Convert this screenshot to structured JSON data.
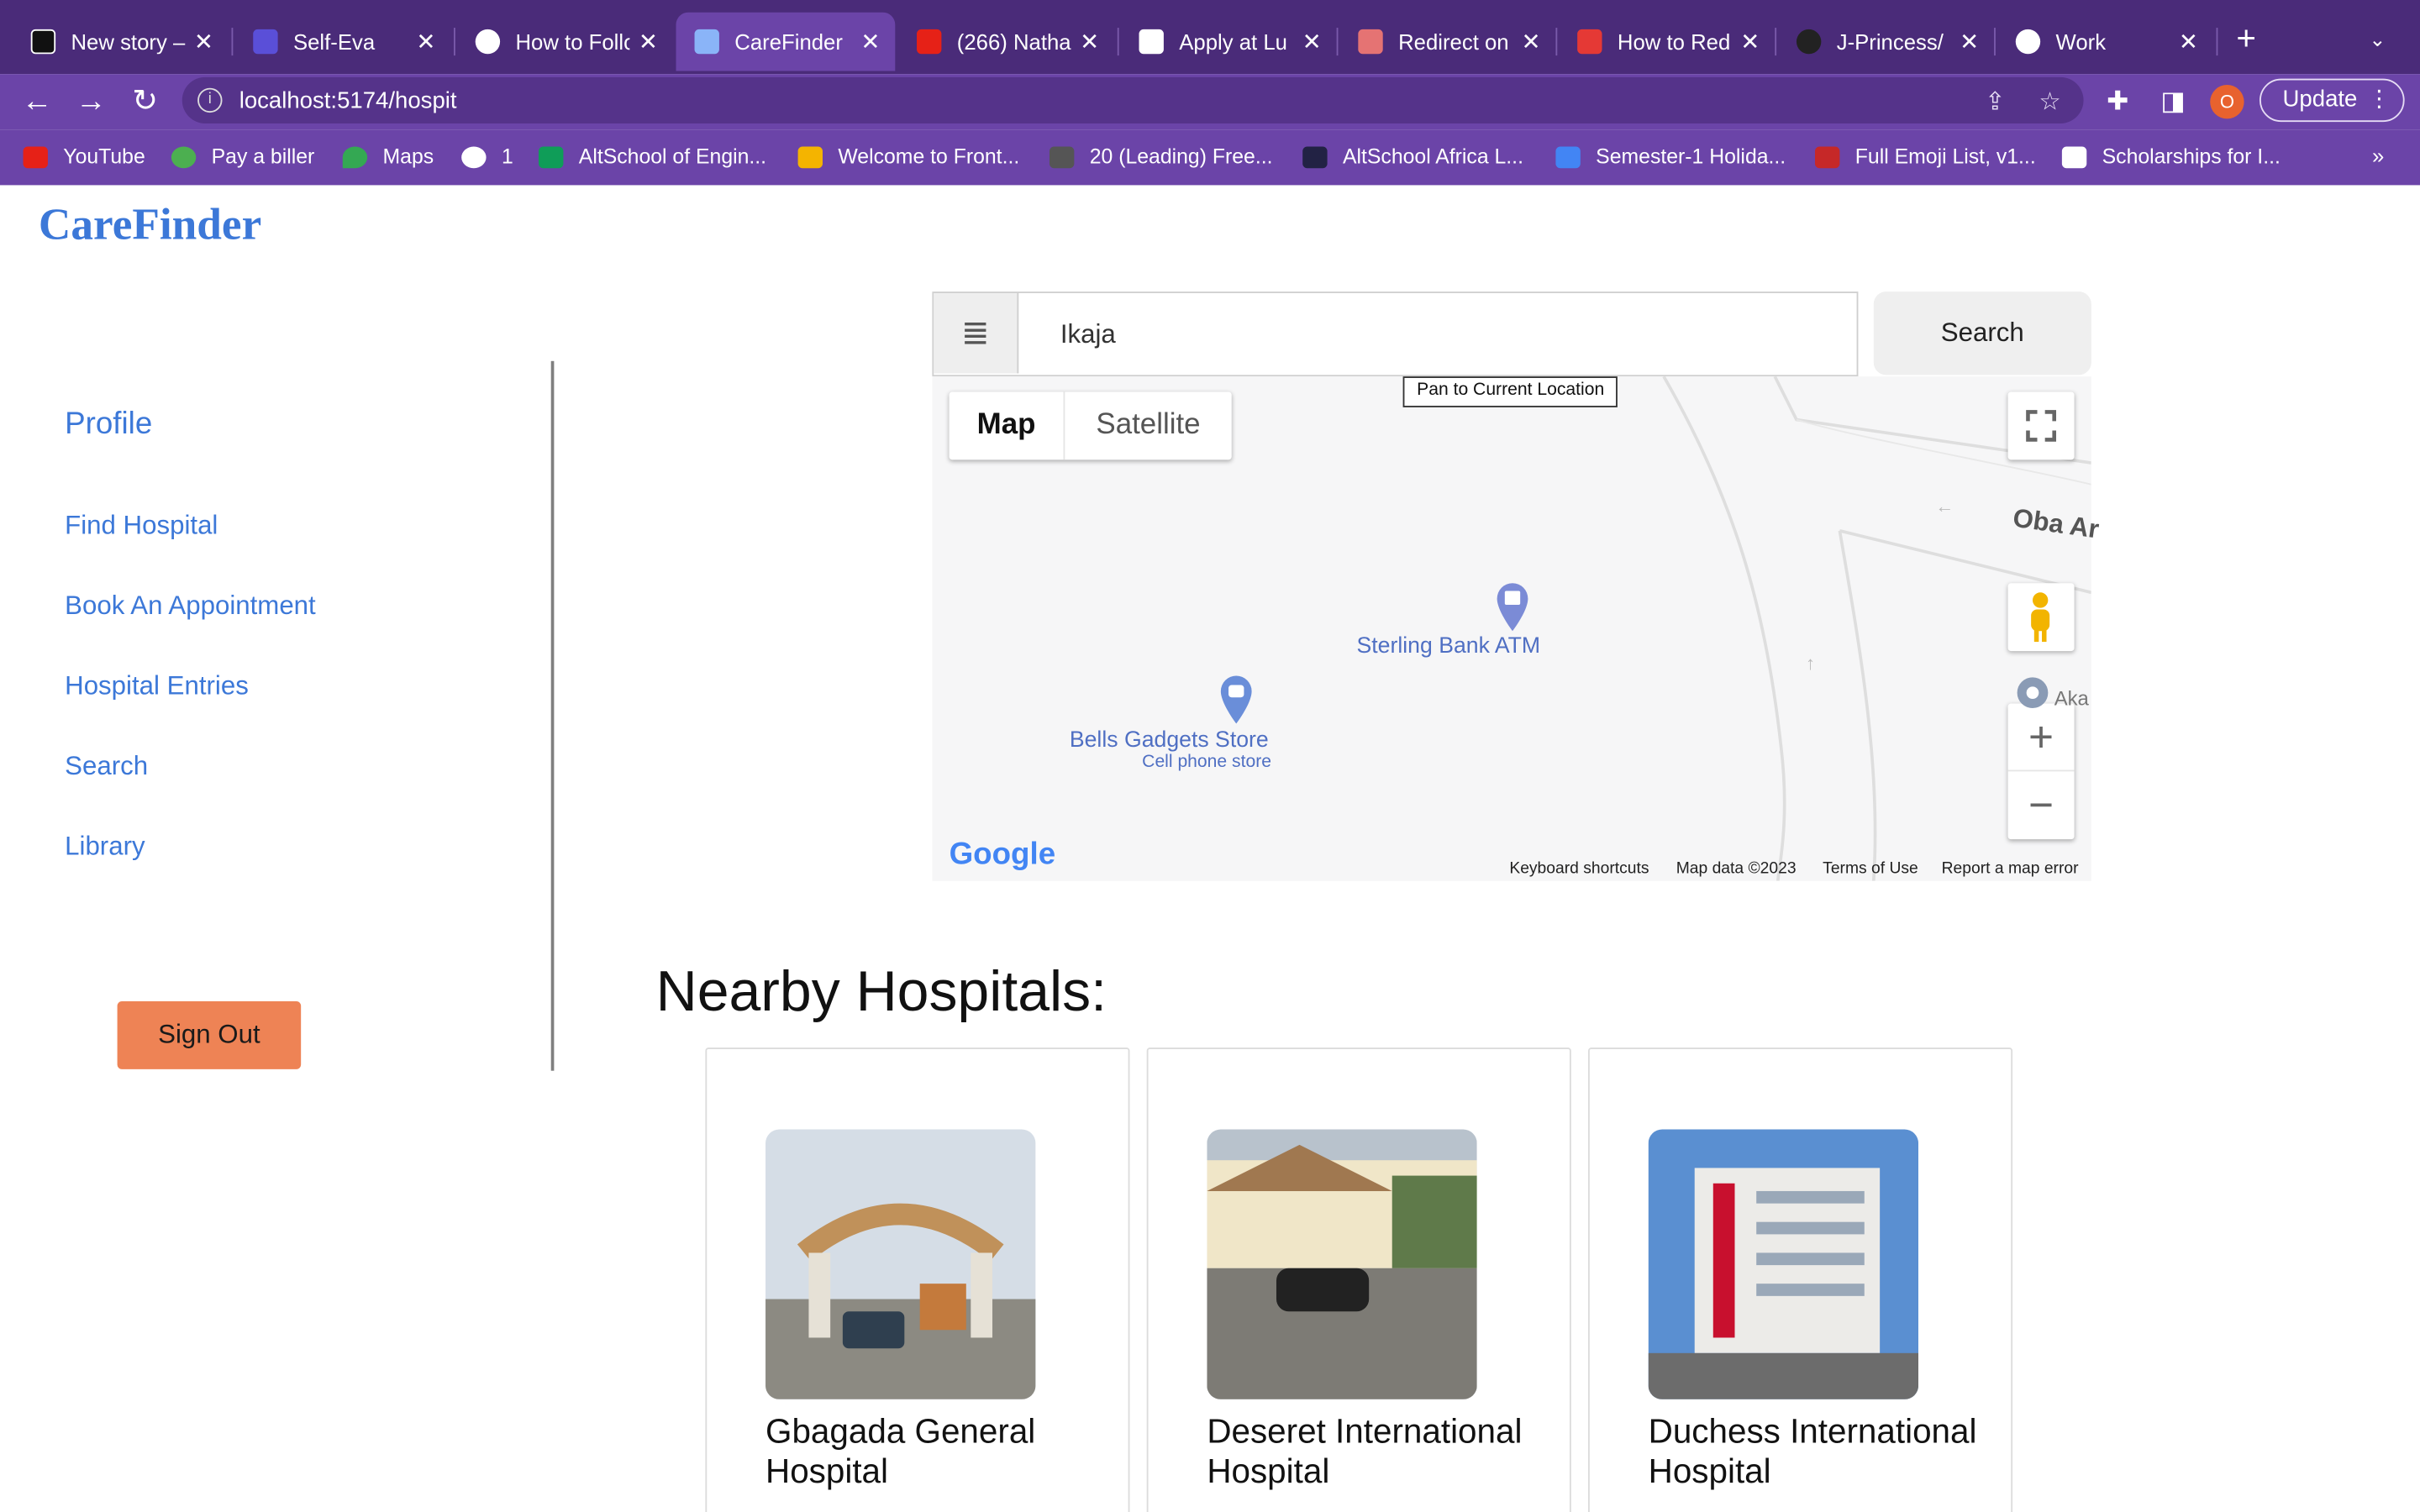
{
  "browser": {
    "tabs": [
      {
        "title": "New story –",
        "icon": "medium-icon",
        "color": "#111111"
      },
      {
        "title": "Self-Eva",
        "icon": "terminal-icon",
        "color": "#5a4fd8"
      },
      {
        "title": "How to Follo",
        "icon": "site-icon",
        "color": "#ffffff"
      },
      {
        "title": "CareFinder",
        "icon": "app-icon",
        "color": "#8ab4f8",
        "active": true
      },
      {
        "title": "(266) Natha",
        "icon": "youtube-icon",
        "color": "#e62117"
      },
      {
        "title": "Apply at Lu",
        "icon": "form-icon",
        "color": "#ffffff"
      },
      {
        "title": "Redirect on",
        "icon": "stack-icon",
        "color": "#e57373"
      },
      {
        "title": "How to Red",
        "icon": "video-icon",
        "color": "#e53935"
      },
      {
        "title": "J-Princess/",
        "icon": "github-icon",
        "color": "#222222"
      },
      {
        "title": "Work",
        "icon": "globe-icon",
        "color": "#ffffff"
      }
    ],
    "url": "localhost:5174/hospit",
    "update_label": "Update",
    "profile_initial": "O",
    "bookmarks": [
      {
        "label": "YouTube",
        "color": "#e62117"
      },
      {
        "label": "Pay a biller",
        "color": "#4caf50"
      },
      {
        "label": "Maps",
        "color": "#34a853"
      },
      {
        "label": "1",
        "color": "#ffffff"
      },
      {
        "label": "AltSchool of Engin...",
        "color": "#0f9d58"
      },
      {
        "label": "Welcome to Front...",
        "color": "#f4b400"
      },
      {
        "label": "20 (Leading) Free...",
        "color": "#555555"
      },
      {
        "label": "AltSchool Africa L...",
        "color": "#222244"
      },
      {
        "label": "Semester-1 Holida...",
        "color": "#4285f4"
      },
      {
        "label": "Full Emoji List, v1...",
        "color": "#c62828"
      },
      {
        "label": "Scholarships for I...",
        "color": "#ffffff"
      }
    ],
    "bookmarks_more": "»"
  },
  "app": {
    "logo": "CareFinder",
    "nav": {
      "profile": "Profile",
      "find_hospital": "Find Hospital",
      "book_appointment": "Book An Appointment",
      "hospital_entries": "Hospital Entries",
      "search": "Search",
      "library": "Library"
    },
    "sign_out": "Sign Out",
    "search": {
      "query": "Ikaja",
      "button": "Search"
    },
    "map": {
      "pan_tooltip": "Pan to Current Location",
      "type_map": "Map",
      "type_satellite": "Satellite",
      "poi_atm": "Sterling Bank ATM",
      "poi_store": "Bells Gadgets Store",
      "poi_store_sub": "Cell phone store",
      "road": "Oba Ar",
      "poi_edge": "Aka",
      "google": "Google",
      "footer_shortcuts": "Keyboard shortcuts",
      "footer_data": "Map data ©2023",
      "footer_terms": "Terms of Use",
      "footer_report": "Report a map error"
    },
    "nearby_title": "Nearby Hospitals:",
    "hospitals": [
      {
        "name": "Gbagada General Hospital"
      },
      {
        "name": "Deseret International Hospital"
      },
      {
        "name": "Duchess International Hospital"
      }
    ]
  }
}
